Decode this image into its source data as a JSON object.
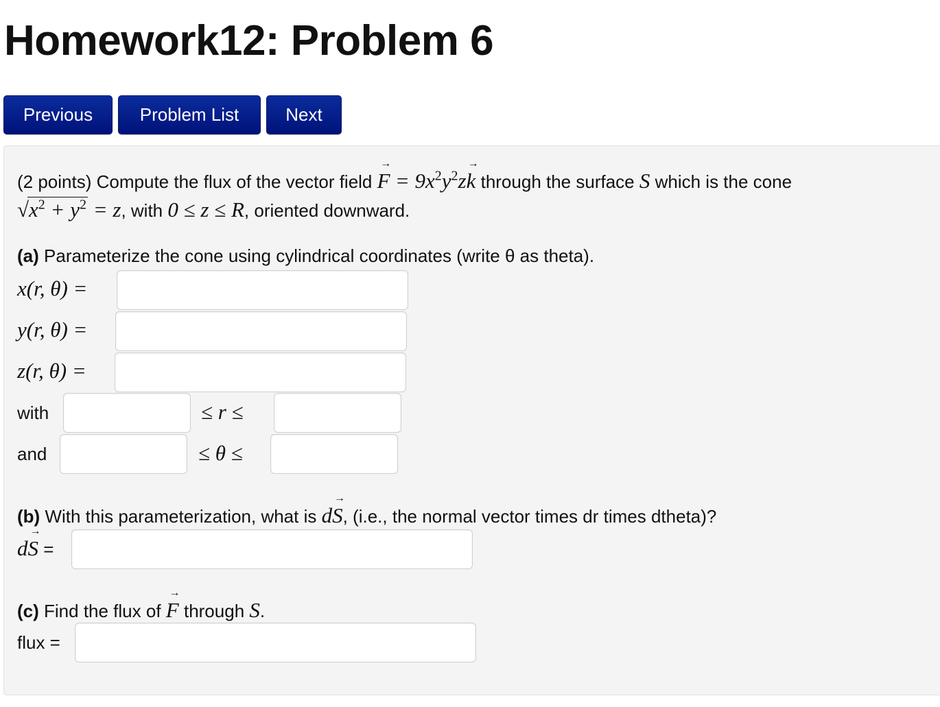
{
  "page": {
    "title": "Homework12: Problem 6"
  },
  "nav": {
    "previous_label": "Previous",
    "problem_list_label": "Problem List",
    "next_label": "Next"
  },
  "problem": {
    "points": "(2 points)",
    "intro_a": "Compute the flux of the vector field",
    "field_lhs": "F",
    "field_rhs": "= 9x²y²zk",
    "intro_b": "through the surface",
    "surface": "S",
    "intro_c": "which is the cone",
    "cone_eq": "√(x² + y²) = z",
    "with_text": ", with",
    "z_range": "0 ≤ z ≤ R",
    "orientation": ", oriented downward.",
    "part_a": {
      "label": "(a)",
      "text": "Parameterize the cone using cylindrical coordinates (write θ as theta).",
      "x_label": "x(r, θ) =",
      "y_label": "y(r, θ) =",
      "z_label": "z(r, θ) =",
      "x_value": "",
      "y_value": "",
      "z_value": "",
      "with_label": "with",
      "and_label": "and",
      "r_between": "≤ r ≤",
      "theta_between": "≤ θ ≤",
      "r_min": "",
      "r_max": "",
      "theta_min": "",
      "theta_max": ""
    },
    "part_b": {
      "label": "(b)",
      "text_a": "With this parameterization, what is",
      "ds_symbol": "dS",
      "text_b": ", (i.e., the normal vector times dr times dtheta)?",
      "answer_label_eq": "=",
      "value": ""
    },
    "part_c": {
      "label": "(c)",
      "text_a": "Find the flux of",
      "f_symbol": "F",
      "text_b": "through",
      "s_symbol": "S",
      "period": ".",
      "answer_label": "flux =",
      "value": ""
    }
  }
}
